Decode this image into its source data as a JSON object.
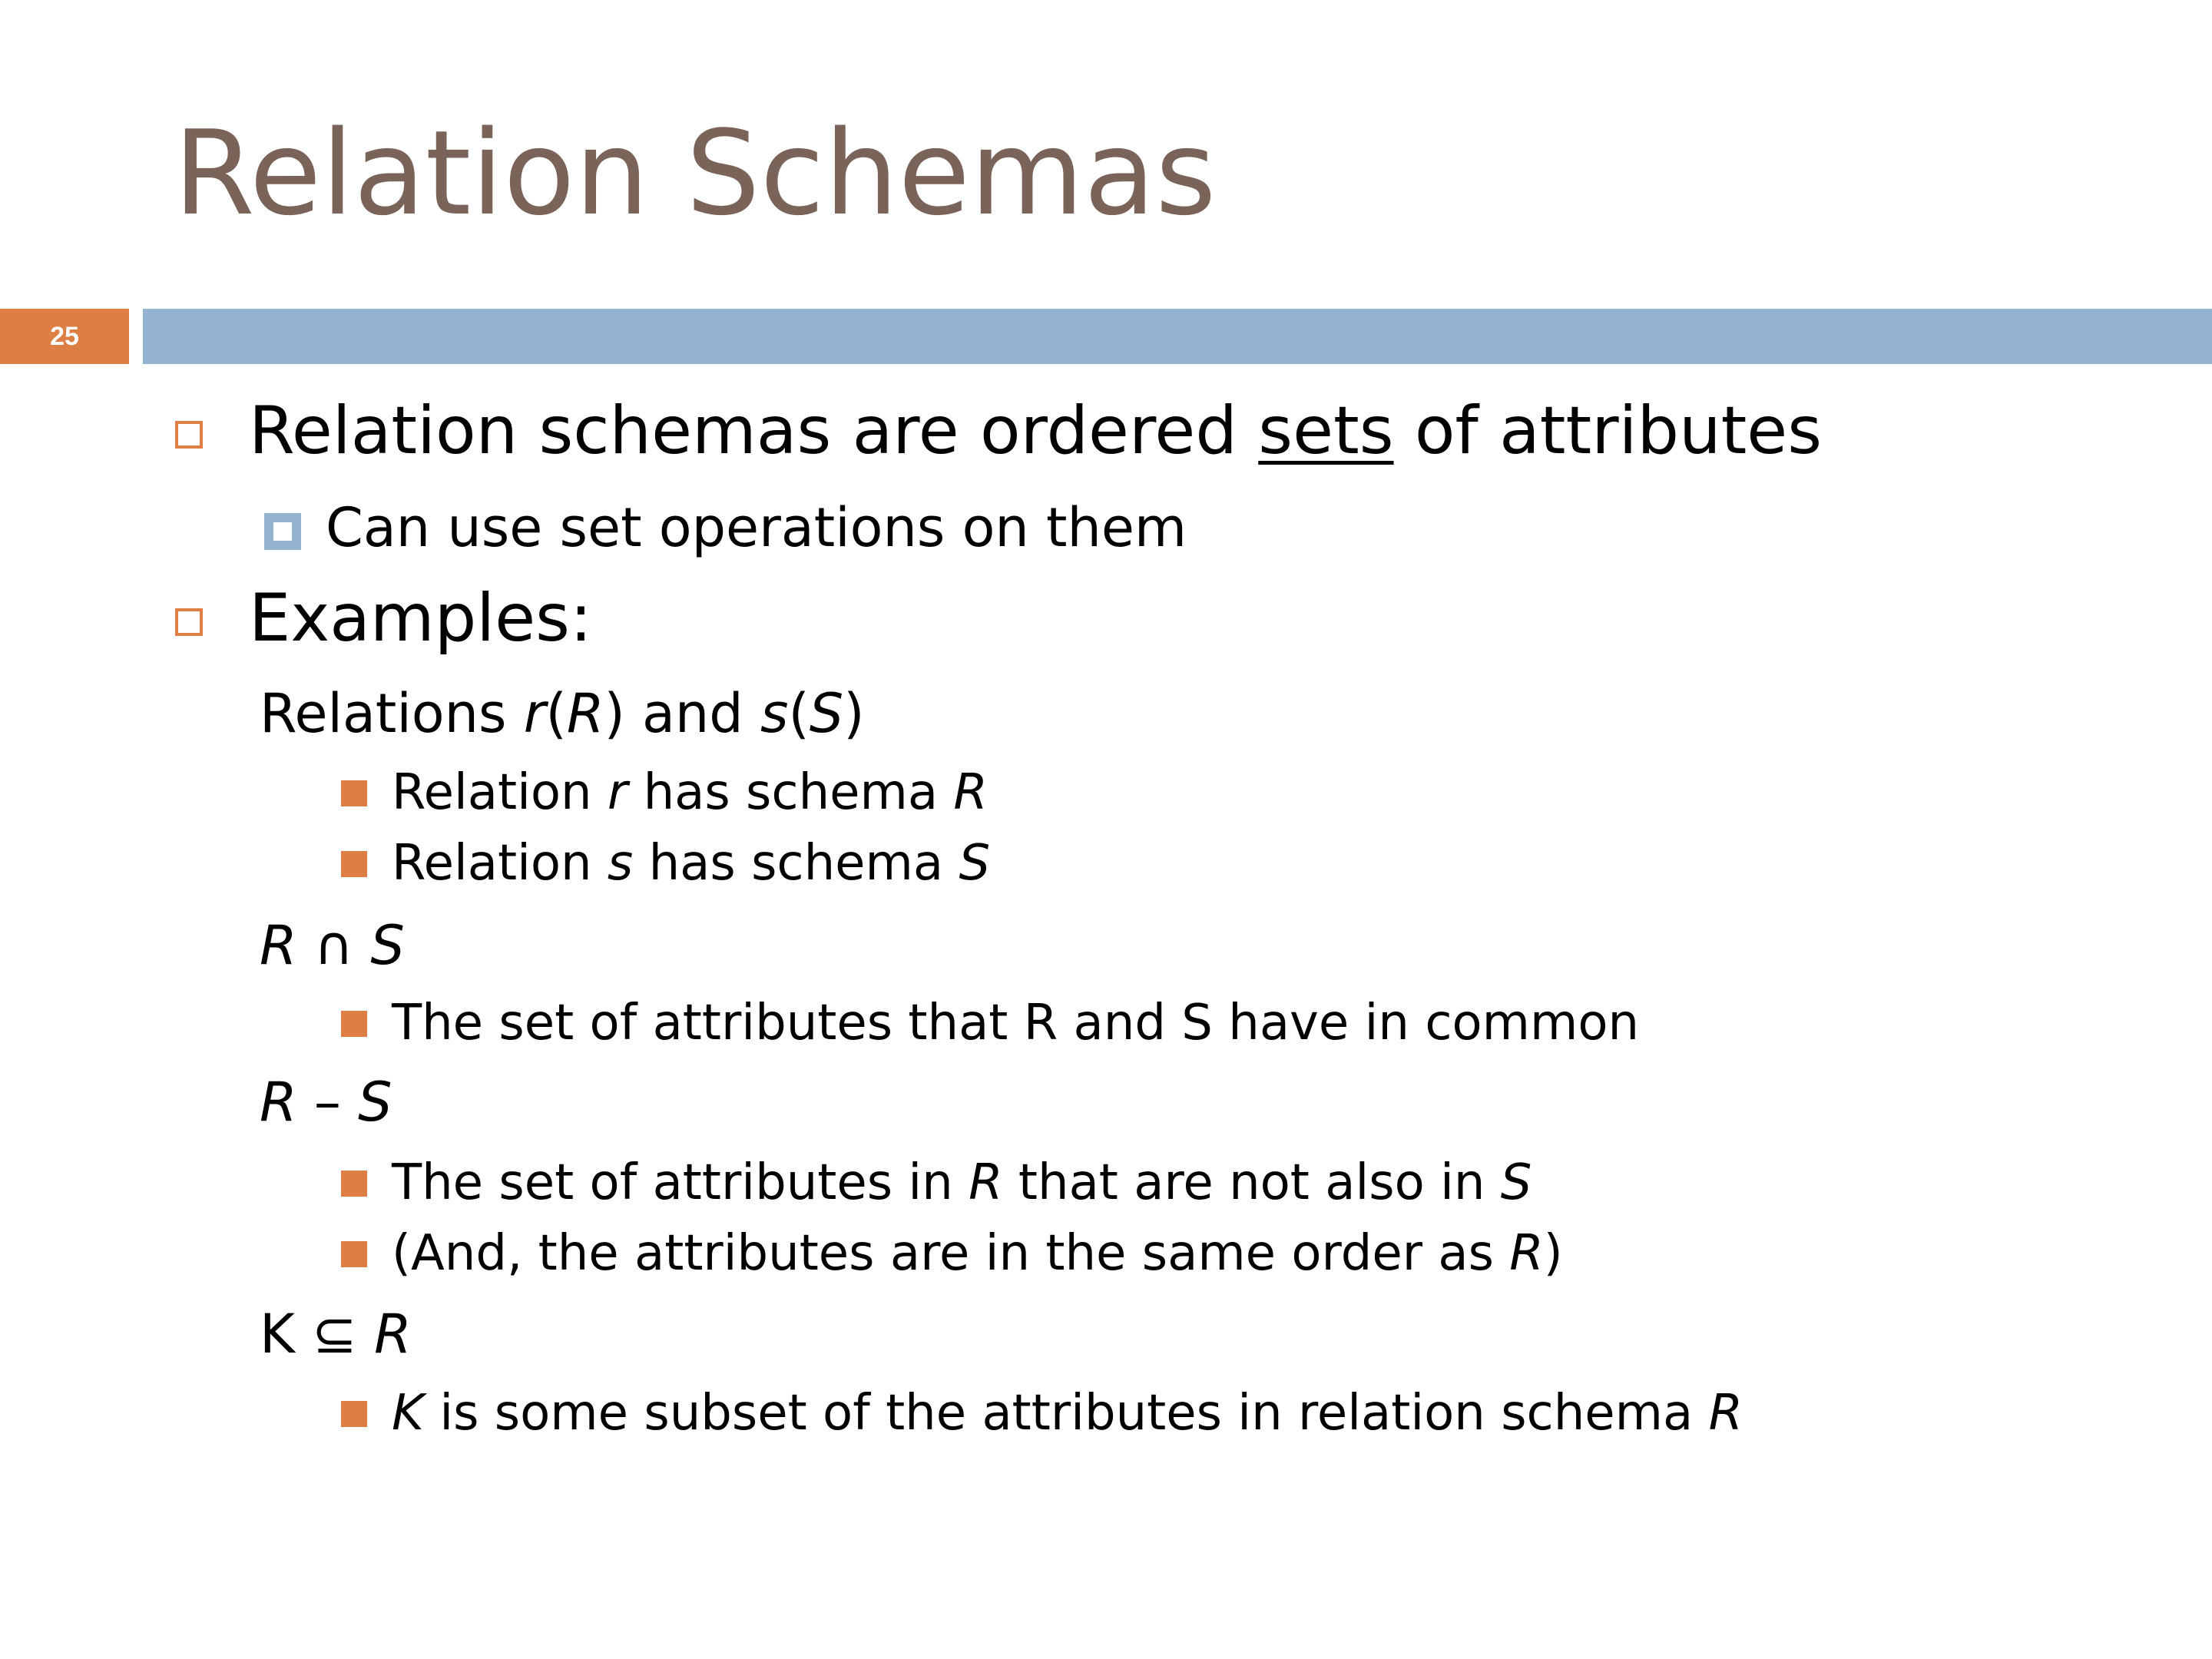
{
  "slide": {
    "title": "Relation Schemas",
    "slide_number": "25",
    "colors": {
      "title": "#7a6358",
      "accent": "#dd7e45",
      "bar": "#94b4d1"
    }
  },
  "content": {
    "b1": {
      "pre": "Relation schemas are ordered ",
      "underlined": "sets",
      "post": " of attributes"
    },
    "b1_sub": "Can use set operations on them",
    "b2": "Examples:",
    "relations": {
      "pre": "Relations ",
      "r": "r",
      "p1": "(",
      "R": "R",
      "p2": ") and ",
      "s": "s",
      "p3": "(",
      "S": "S",
      "p4": ")"
    },
    "rel_r": {
      "pre": "Relation ",
      "r": "r",
      "mid": " has schema ",
      "R": "R"
    },
    "rel_s": {
      "pre": "Relation ",
      "s": "s",
      "mid": " has schema ",
      "S": "S"
    },
    "intersect": {
      "R": "R",
      "op": " ∩ ",
      "S": "S"
    },
    "intersect_desc": "The set of attributes that R and S have in common",
    "minus": {
      "R": "R",
      "op": " – ",
      "S": "S"
    },
    "minus_desc1": {
      "pre": "The set of attributes in ",
      "R": "R",
      "mid": " that are not also in ",
      "S": "S"
    },
    "minus_desc2": {
      "pre": "(And, the attributes are in the same order as ",
      "R": "R",
      "post": ")"
    },
    "subset": {
      "K": "K",
      "op": " ⊆ ",
      "R": "R"
    },
    "subset_desc": {
      "K": "K",
      "mid": " is some subset of the attributes in relation schema ",
      "R": "R"
    }
  }
}
